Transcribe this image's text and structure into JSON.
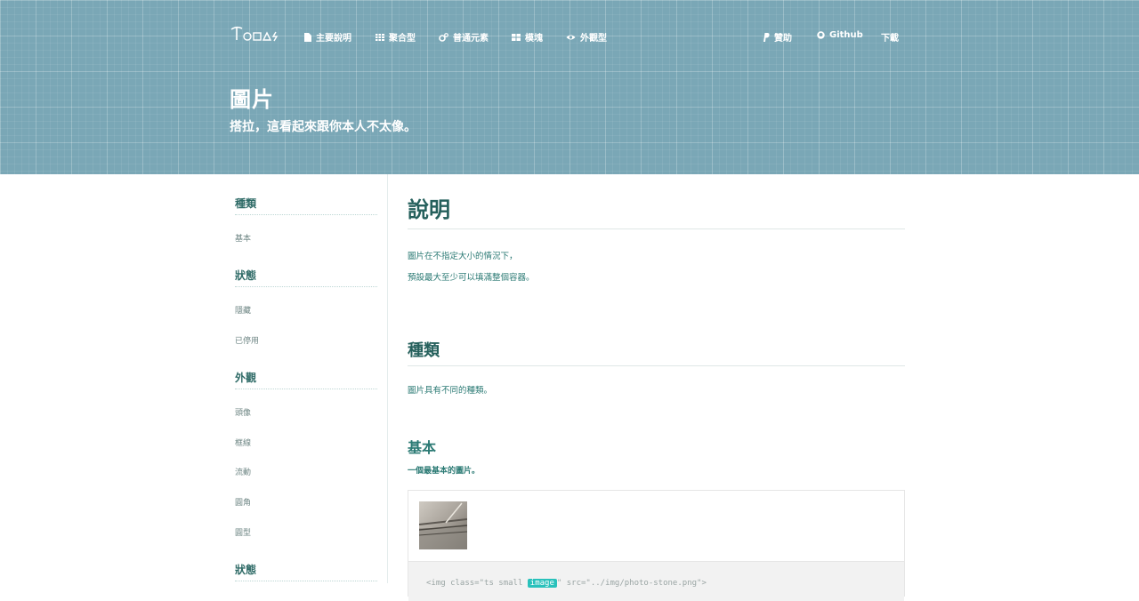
{
  "nav": {
    "brand": "TOCAS",
    "items": [
      {
        "label": "主要說明",
        "icon": "file-icon"
      },
      {
        "label": "聚合型",
        "icon": "grid-icon"
      },
      {
        "label": "普通元素",
        "icon": "cogs-icon"
      },
      {
        "label": "模塊",
        "icon": "blocks-icon"
      },
      {
        "label": "外觀型",
        "icon": "eye-icon"
      }
    ],
    "right": [
      {
        "label": "贊助",
        "icon": "paypal-icon"
      },
      {
        "label": "Github",
        "icon": "github-icon"
      },
      {
        "label": "下載"
      }
    ]
  },
  "header": {
    "title": "圖片",
    "subtitle": "搭拉，這看起來跟你本人不太像。"
  },
  "sidebar": {
    "sections": [
      {
        "heading": "種類",
        "items": [
          "基本"
        ]
      },
      {
        "heading": "狀態",
        "items": [
          "隱藏",
          "已停用"
        ]
      },
      {
        "heading": "外觀",
        "items": [
          "頭像",
          "框線",
          "流動",
          "圓角",
          "圓型"
        ]
      },
      {
        "heading": "狀態",
        "items": []
      }
    ]
  },
  "main": {
    "explain_heading": "說明",
    "explain_lines": [
      "圖片在不指定大小的情況下，",
      "預設最大至少可以填滿整個容器。"
    ],
    "types_heading": "種類",
    "types_desc": "圖片具有不同的種類。",
    "basic_heading": "基本",
    "basic_desc": "一個最基本的圖片。",
    "code": {
      "before": "<img class=\"ts small ",
      "highlight": "image",
      "after": "\" src=\"../img/photo-stone.png\">"
    }
  },
  "colors": {
    "header_bg": "#7aa7b6",
    "accent": "#29c1bb",
    "text_dark": "#25605c"
  }
}
